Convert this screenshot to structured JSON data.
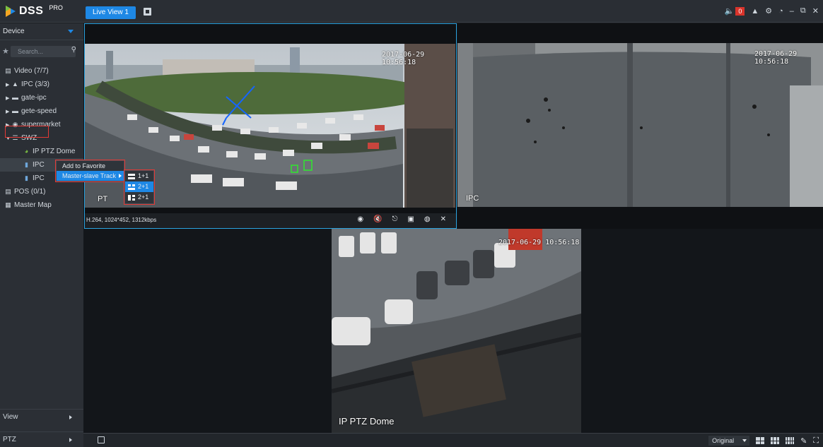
{
  "app": {
    "logo": "DSS",
    "logo_sup": "PRO"
  },
  "tabs": [
    {
      "label": "Live View 1"
    }
  ],
  "topbar": {
    "alarm_count": "0",
    "window_controls": [
      "minimize-icon",
      "restore-icon",
      "close-icon"
    ]
  },
  "sidebar": {
    "header": "Device",
    "search_placeholder": "Search...",
    "tree": [
      {
        "label": "Video (7/7)",
        "icon": "video-group-icon",
        "level": 0
      },
      {
        "label": "IPC (3/3)",
        "icon": "org-icon",
        "level": 1,
        "expander": "collapsed"
      },
      {
        "label": "gate-ipc",
        "icon": "nvr-icon",
        "level": 1,
        "expander": "collapsed"
      },
      {
        "label": "gete-speed",
        "icon": "nvr-icon",
        "level": 1,
        "expander": "collapsed"
      },
      {
        "label": "supermarket",
        "icon": "supermarket-icon",
        "level": 1,
        "expander": "collapsed"
      },
      {
        "label": "SWZ",
        "icon": "swz-icon",
        "level": 1,
        "expander": "expanded"
      },
      {
        "label": "IP PTZ Dome",
        "icon": "ptz-dome-icon",
        "level": 2
      },
      {
        "label": "IPC",
        "icon": "ipc-icon",
        "level": 2,
        "selected": true
      },
      {
        "label": "IPC",
        "icon": "ipc-icon",
        "level": 2
      },
      {
        "label": "POS (0/1)",
        "icon": "pos-icon",
        "level": 0
      },
      {
        "label": "Master Map",
        "icon": "map-icon",
        "level": 0
      }
    ],
    "bottom_panels": [
      "View",
      "PTZ"
    ]
  },
  "context_menu": {
    "items": [
      {
        "label": "Add to Favorite"
      },
      {
        "label": "Master-slave Track",
        "highlighted": true
      }
    ],
    "submenu": [
      {
        "label": "1+1"
      },
      {
        "label": "2+1",
        "highlighted": true
      },
      {
        "label": "2+1"
      }
    ]
  },
  "video": {
    "cells": [
      {
        "timestamp": "2017-06-29 10:56:18",
        "label": "PT",
        "stream_info": "H.264, 1024*452, 1312kbps",
        "active": true
      },
      {
        "timestamp": "2017-06-29 10:56:18",
        "label": "IPC",
        "active": false
      },
      {
        "timestamp": "2017-06-29 10:56:18",
        "label": "IP PTZ Dome",
        "active": false
      }
    ],
    "cell_controls": [
      "play-icon",
      "mute-icon",
      "mic-icon",
      "record-icon",
      "snapshot-icon",
      "close-icon"
    ]
  },
  "bottombar": {
    "ratio_value": "Original"
  },
  "colors": {
    "accent": "#1e88e5",
    "highlight_box": "#e53935",
    "active_border": "#2aa3e0"
  }
}
